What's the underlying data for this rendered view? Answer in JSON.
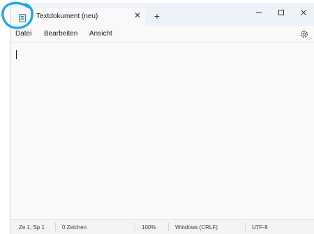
{
  "titlebar": {
    "tab_title": "Textdokument (neu)",
    "tab_close_glyph": "✕",
    "new_tab_glyph": "+",
    "app_icon": "notepad-icon",
    "window_buttons": [
      "minimize-icon",
      "maximize-icon",
      "close-icon"
    ]
  },
  "menu": {
    "file": "Datei",
    "edit": "Bearbeiten",
    "view": "Ansicht",
    "settings_icon": "gear-icon"
  },
  "editor": {
    "content": ""
  },
  "status": {
    "position": "Ze 1, Sp 1",
    "characters": "0 Zeichen",
    "zoom": "100%",
    "line_ending": "Windows (CRLF)",
    "encoding": "UTF-8"
  },
  "colors": {
    "annotation": "#2aa7e0",
    "titlebar_bg": "#eef3f9",
    "editor_bg": "#f9f9f9",
    "statusbar_bg": "#f3f3f3"
  }
}
